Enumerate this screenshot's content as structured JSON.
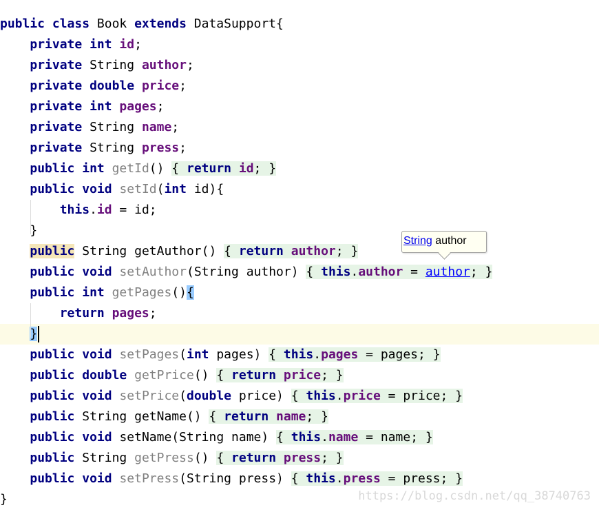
{
  "editor": {
    "class_decl": {
      "public": "public",
      "class": "class",
      "name": " Book ",
      "extends": "extends",
      "super": " DataSupport",
      "brace": "{"
    },
    "fields": [
      {
        "mod": "private",
        "type": "int",
        "name": "id"
      },
      {
        "mod": "private",
        "type": "String",
        "name": "author"
      },
      {
        "mod": "private",
        "type": "double",
        "name": "price"
      },
      {
        "mod": "private",
        "type": "int",
        "name": "pages"
      },
      {
        "mod": "private",
        "type": "String",
        "name": "name"
      },
      {
        "mod": "private",
        "type": "String",
        "name": "press"
      }
    ],
    "kw": {
      "public": "public",
      "int": "int",
      "void": "void",
      "double": "double",
      "return": "return",
      "this": "this",
      "String": "String"
    },
    "methods": {
      "getId": "getId",
      "setId": "setId",
      "getAuthor": "getAuthor",
      "setAuthor": "setAuthor",
      "getPages": "getPages",
      "setPages": "setPages",
      "getPrice": "getPrice",
      "setPrice": "setPrice",
      "getName": "getName",
      "setName": "setName",
      "getPress": "getPress",
      "setPress": "setPress"
    },
    "params": {
      "id": "id",
      "author": "author",
      "pages": "pages",
      "price": "price",
      "name": "name",
      "press": "press"
    }
  },
  "tooltip": {
    "type_link": "String",
    "field_name": " author"
  },
  "watermark": "https://blog.csdn.net/qq_38740763",
  "colors": {
    "keyword": "#000080",
    "field": "#660e7a",
    "unused_method": "#808080",
    "fold_bg": "#e6f4e6",
    "current_line": "#fdfbe6",
    "brace_match": "#99ccff",
    "link": "#0000ff"
  }
}
